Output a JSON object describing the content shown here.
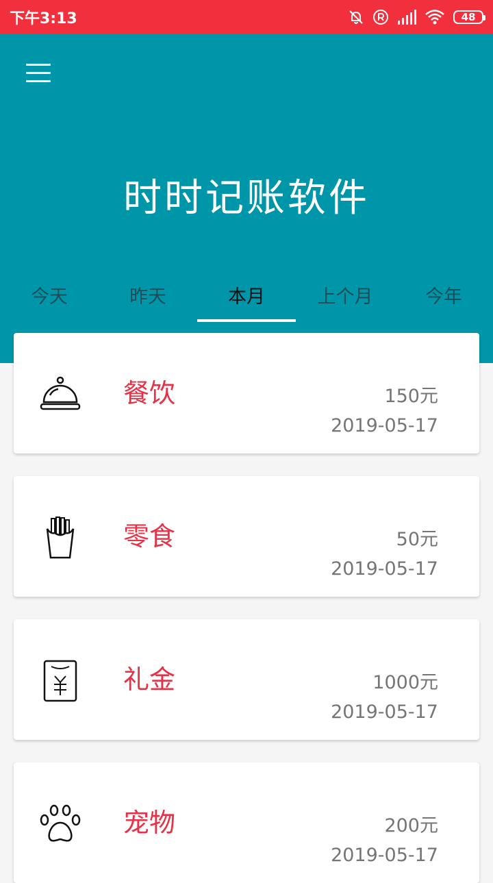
{
  "status_bar": {
    "time": "下午3:13",
    "battery": "48",
    "icons": [
      "bell-off-icon",
      "registered-icon",
      "signal-icon",
      "wifi-icon",
      "battery-icon"
    ],
    "color": "#f2303d"
  },
  "header": {
    "title": "时时记账软件",
    "color": "#0096a9",
    "menu_icon": "menu-icon"
  },
  "tabs": [
    {
      "label": "今天",
      "active": false
    },
    {
      "label": "昨天",
      "active": false
    },
    {
      "label": "本月",
      "active": true
    },
    {
      "label": "上个月",
      "active": false
    },
    {
      "label": "今年",
      "active": false
    }
  ],
  "records": [
    {
      "category": "餐饮",
      "amount": "150元",
      "date": "2019-05-17",
      "icon": "food-cloche-icon"
    },
    {
      "category": "零食",
      "amount": "50元",
      "date": "2019-05-17",
      "icon": "fries-icon"
    },
    {
      "category": "礼金",
      "amount": "1000元",
      "date": "2019-05-17",
      "icon": "red-envelope-icon"
    },
    {
      "category": "宠物",
      "amount": "200元",
      "date": "2019-05-17",
      "icon": "paw-icon"
    }
  ],
  "colors": {
    "category_text": "#e73146",
    "secondary_text": "#757575"
  }
}
